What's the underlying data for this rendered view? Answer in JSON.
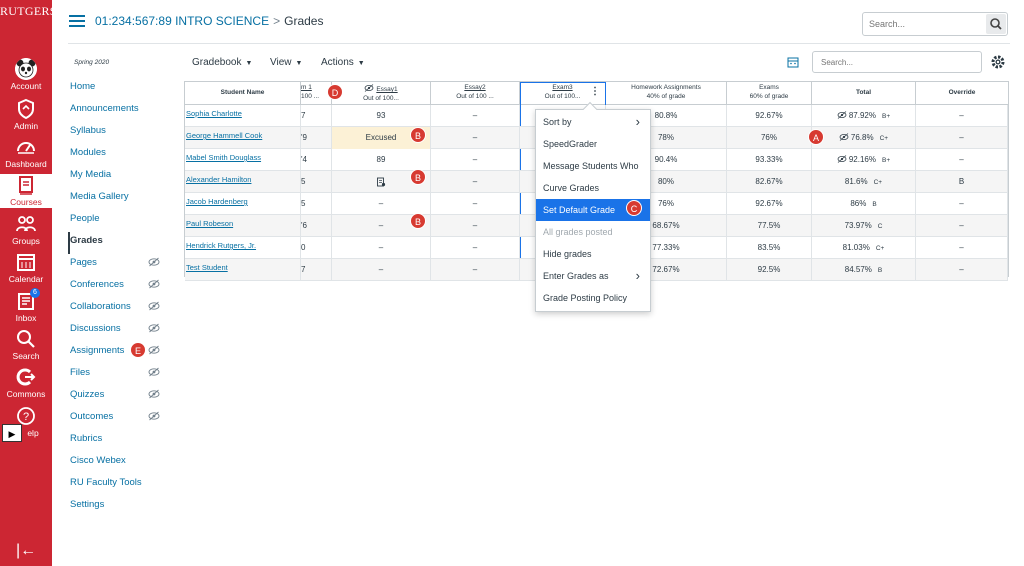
{
  "brand": {
    "logo_text": "RUTGERS",
    "nav_color": "#cc2633",
    "accent": "#0770a3"
  },
  "global_nav": {
    "items": [
      {
        "label": "Account",
        "icon": "panda-avatar-icon"
      },
      {
        "label": "Admin",
        "icon": "shield-icon"
      },
      {
        "label": "Dashboard",
        "icon": "dashboard-icon"
      },
      {
        "label": "Courses",
        "icon": "book-icon"
      },
      {
        "label": "Groups",
        "icon": "groups-icon"
      },
      {
        "label": "Calendar",
        "icon": "calendar-icon"
      },
      {
        "label": "Inbox",
        "icon": "inbox-icon",
        "badge": "6"
      },
      {
        "label": "Search",
        "icon": "search-icon"
      },
      {
        "label": "Commons",
        "icon": "commons-icon"
      },
      {
        "label": "elp",
        "icon": "help-icon"
      }
    ],
    "play_glyph": "▶",
    "collapse_glyph": "|←"
  },
  "header": {
    "course": "01:234:567:89 INTRO SCIENCE",
    "separator": ">",
    "page": "Grades",
    "search_placeholder": "Search..."
  },
  "course_nav": {
    "term": "Spring 2020",
    "items": [
      {
        "label": "Home",
        "hidden": false
      },
      {
        "label": "Announcements",
        "hidden": false
      },
      {
        "label": "Syllabus",
        "hidden": false
      },
      {
        "label": "Modules",
        "hidden": false
      },
      {
        "label": "My Media",
        "hidden": false
      },
      {
        "label": "Media Gallery",
        "hidden": false
      },
      {
        "label": "People",
        "hidden": false
      },
      {
        "label": "Grades",
        "hidden": false,
        "active": true
      },
      {
        "label": "Pages",
        "hidden": true
      },
      {
        "label": "Conferences",
        "hidden": true
      },
      {
        "label": "Collaborations",
        "hidden": true
      },
      {
        "label": "Discussions",
        "hidden": true
      },
      {
        "label": "Assignments",
        "hidden": true
      },
      {
        "label": "Files",
        "hidden": true
      },
      {
        "label": "Quizzes",
        "hidden": true
      },
      {
        "label": "Outcomes",
        "hidden": true
      },
      {
        "label": "Rubrics",
        "hidden": false
      },
      {
        "label": "Cisco Webex",
        "hidden": false
      },
      {
        "label": "RU Faculty Tools",
        "hidden": false
      },
      {
        "label": "Settings",
        "hidden": false
      }
    ]
  },
  "toolbar": {
    "gradebook": "Gradebook",
    "view": "View",
    "actions": "Actions",
    "caret": "▼",
    "search_placeholder": "Search..."
  },
  "grid": {
    "headers": {
      "student": "Student Name",
      "exam1_title": "m 1",
      "exam1_sub": "100 ...",
      "essay1_title": "Essay1",
      "essay1_sub": "Out of 100...",
      "essay2_title": "Essay2",
      "essay2_sub": "Out of 100 ...",
      "exam3_title": "Exam3",
      "exam3_sub": "Out of 100...",
      "homework_title": "Homework Assignments",
      "homework_sub": "40% of grade",
      "exams_title": "Exams",
      "exams_sub": "60% of grade",
      "total": "Total",
      "override": "Override"
    },
    "rows": [
      {
        "name": "Sophia Charlotte",
        "exam1": "7",
        "essay1": "93",
        "essay2": "–",
        "homework": "80.8%",
        "exams": "92.67%",
        "total": "87.92%",
        "letter": "B+",
        "override": "–"
      },
      {
        "name": "George Hammell Cook",
        "exam1": "'9",
        "essay1": "Excused",
        "essay2": "–",
        "homework": "78%",
        "exams": "76%",
        "total": "76.8%",
        "letter": "C+",
        "override": "–"
      },
      {
        "name": "Mabel Smith Douglass",
        "exam1": "'4",
        "essay1": "89",
        "essay2": "–",
        "homework": "90.4%",
        "exams": "93.33%",
        "total": "92.16%",
        "letter": "B+",
        "override": "–"
      },
      {
        "name": "Alexander Hamilton",
        "exam1": "5",
        "essay1": "",
        "essay2": "–",
        "homework": "80%",
        "exams": "82.67%",
        "total": "81.6%",
        "letter": "C+",
        "override": "B"
      },
      {
        "name": "Jacob Hardenberg",
        "exam1": "5",
        "essay1": "–",
        "essay2": "–",
        "homework": "76%",
        "exams": "92.67%",
        "total": "86%",
        "letter": "B",
        "override": "–"
      },
      {
        "name": "Paul Robeson",
        "exam1": "'6",
        "essay1": "–",
        "essay2": "–",
        "homework": "68.67%",
        "exams": "77.5%",
        "total": "73.97%",
        "letter": "C",
        "override": "–"
      },
      {
        "name": "Hendrick Rutgers, Jr.",
        "exam1": "0",
        "essay1": "–",
        "essay2": "–",
        "homework": "77.33%",
        "exams": "83.5%",
        "total": "81.03%",
        "letter": "C+",
        "override": "–"
      },
      {
        "name": "Test Student",
        "exam1": "7",
        "essay1": "–",
        "essay2": "–",
        "homework": "72.67%",
        "exams": "92.5%",
        "total": "84.57%",
        "letter": "B",
        "override": "–"
      }
    ]
  },
  "menu": {
    "items": [
      {
        "label": "Sort by",
        "submenu": true
      },
      {
        "label": "SpeedGrader"
      },
      {
        "label": "Message Students Who"
      },
      {
        "label": "Curve Grades"
      },
      {
        "label": "Set Default Grade",
        "selected": true
      },
      {
        "label": "All grades posted",
        "disabled": true
      },
      {
        "label": "Hide grades"
      },
      {
        "label": "Enter Grades as",
        "submenu": true
      },
      {
        "label": "Grade Posting Policy"
      }
    ],
    "arrow": "›"
  },
  "markers": {
    "a": "A",
    "b": "B",
    "c": "C",
    "d": "D",
    "e": "E"
  },
  "kebab": "⋮"
}
